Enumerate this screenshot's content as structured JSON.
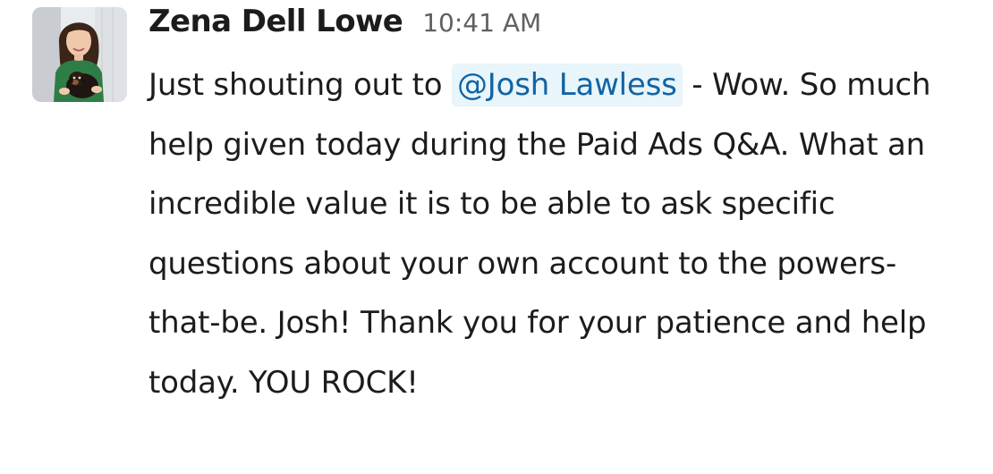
{
  "message": {
    "author": "Zena Dell Lowe",
    "timestamp": "10:41 AM",
    "avatar_icon": "user-avatar-photo",
    "text_before_mention": "Just shouting out to ",
    "mention": "@Josh Lawless",
    "text_after_mention": " - Wow. So much help given today during the Paid Ads Q&A. What an incredible value it is to be able to ask specific questions about your own account to the powers-that-be. Josh! Thank you for your patience and help today. YOU ROCK!"
  },
  "colors": {
    "author_text": "#1d1c1d",
    "timestamp_text": "#616061",
    "mention_text": "#1264a3",
    "mention_background": "#e8f5fa"
  }
}
